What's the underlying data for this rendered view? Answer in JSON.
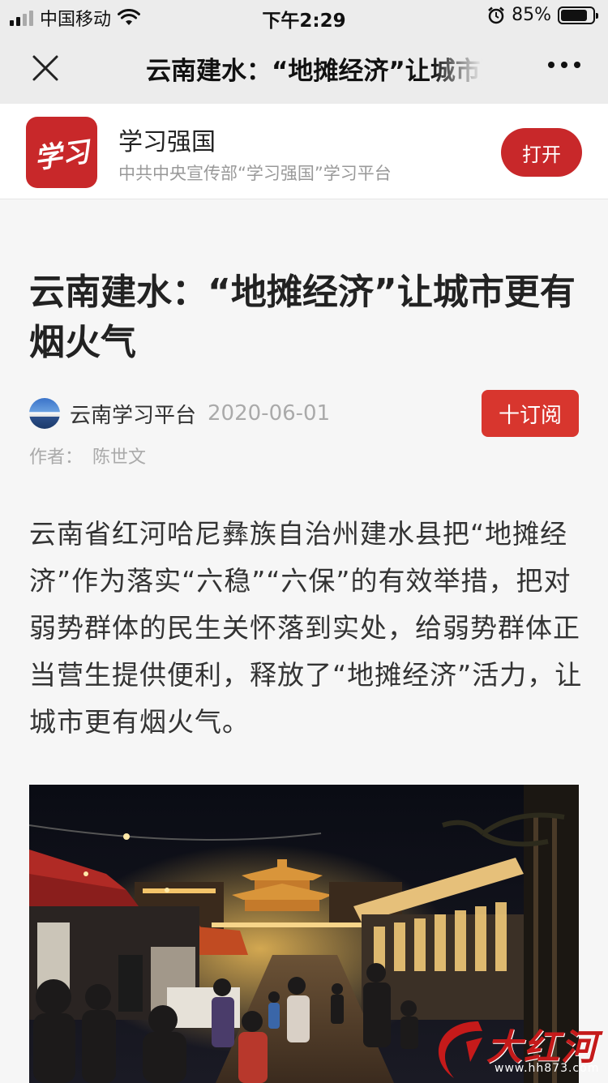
{
  "status_bar": {
    "carrier": "中国移动",
    "time": "下午2:29",
    "battery_percent": "85%",
    "battery_level": 0.85
  },
  "nav": {
    "title": "云南建水：“地摊经济”让城市更有烟火气"
  },
  "app_banner": {
    "name": "学习强国",
    "logo_text": "学习",
    "description": "中共中央宣传部“学习强国”学习平台",
    "open_label": "打开"
  },
  "article": {
    "title": "云南建水：“地摊经济”让城市更有烟火气",
    "source": "云南学习平台",
    "date": "2020-06-01",
    "subscribe_label": "十订阅",
    "author_label": "作者：",
    "author_name": "陈世文",
    "body": "云南省红河哈尼彝族自治州建水县把“地摊经济”作为落实“六稳”“六保”的有效举措，把对弱势群体的民生关怀落到实处，给弱势群体正当营生提供便利，释放了“地摊经济”活力，让城市更有烟火气。"
  },
  "watermark": {
    "text": "大红河",
    "url": "www.hh873.com"
  },
  "icons": {
    "close": "close-icon",
    "more": "more-icon",
    "signal": "signal-icon",
    "wifi": "wifi-icon",
    "alarm": "alarm-icon",
    "battery": "battery-icon"
  },
  "colors": {
    "accent_red": "#c8282a",
    "subscribe_red": "#d8362e",
    "nav_bg": "#ececec",
    "page_bg": "#f6f6f6"
  }
}
